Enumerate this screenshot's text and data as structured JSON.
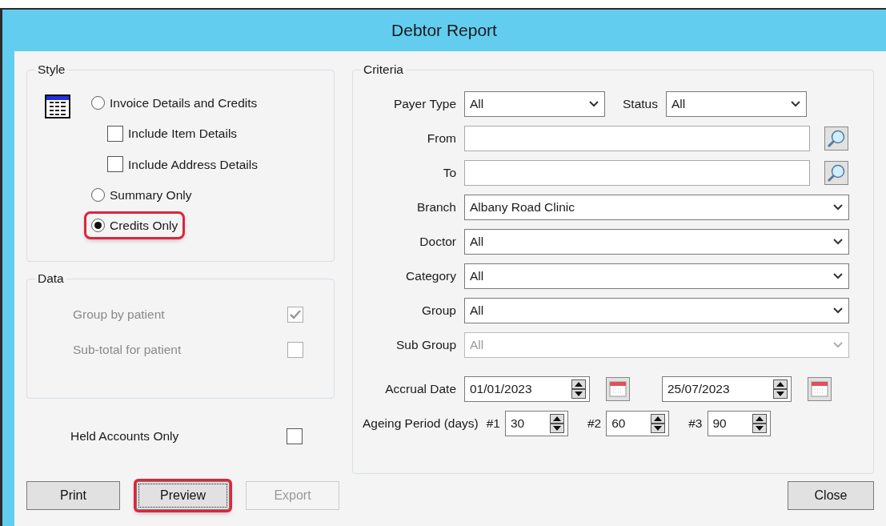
{
  "window": {
    "title": "Debtor Report"
  },
  "style_group": {
    "title": "Style",
    "options": [
      {
        "kind": "radio",
        "label": "Invoice Details and Credits",
        "selected": false,
        "highlighted": false
      },
      {
        "kind": "checkbox",
        "label": "Include Item Details",
        "checked": false
      },
      {
        "kind": "checkbox",
        "label": "Include Address Details",
        "checked": false
      },
      {
        "kind": "radio",
        "label": "Summary Only",
        "selected": false,
        "highlighted": false
      },
      {
        "kind": "radio",
        "label": "Credits Only",
        "selected": true,
        "highlighted": true
      }
    ]
  },
  "data_group": {
    "title": "Data",
    "options": [
      {
        "label": "Group by patient",
        "checked": true,
        "disabled": true
      },
      {
        "label": "Sub-total for patient",
        "checked": false,
        "disabled": true
      }
    ]
  },
  "held_accounts": {
    "label": "Held Accounts Only",
    "checked": false
  },
  "criteria": {
    "title": "Criteria",
    "rows": [
      {
        "kind": "pair",
        "fields": [
          {
            "label": "Payer Type",
            "value": "All"
          },
          {
            "label": "Status",
            "value": "All"
          }
        ]
      },
      {
        "kind": "lookup",
        "label": "From",
        "value": ""
      },
      {
        "kind": "lookup",
        "label": "To",
        "value": ""
      },
      {
        "kind": "combo",
        "label": "Branch",
        "value": "Albany Road Clinic",
        "disabled": false
      },
      {
        "kind": "combo",
        "label": "Doctor",
        "value": "All",
        "disabled": false
      },
      {
        "kind": "combo",
        "label": "Category",
        "value": "All",
        "disabled": false
      },
      {
        "kind": "combo",
        "label": "Group",
        "value": "All",
        "disabled": false
      },
      {
        "kind": "combo",
        "label": "Sub Group",
        "value": "All",
        "disabled": true
      },
      {
        "kind": "dates",
        "label": "Accrual Date",
        "values": [
          "01/01/2023",
          "25/07/2023"
        ]
      },
      {
        "kind": "ageing",
        "label": "Ageing Period (days)",
        "periods": [
          {
            "label": "#1",
            "value": "30"
          },
          {
            "label": "#2",
            "value": "60"
          },
          {
            "label": "#3",
            "value": "90"
          }
        ]
      }
    ]
  },
  "buttons": [
    {
      "label": "Print",
      "disabled": false,
      "highlighted": false,
      "focused": false
    },
    {
      "label": "Preview",
      "disabled": false,
      "highlighted": true,
      "focused": true
    },
    {
      "label": "Export",
      "disabled": true,
      "highlighted": false,
      "focused": false
    }
  ],
  "close_button": {
    "label": "Close"
  }
}
